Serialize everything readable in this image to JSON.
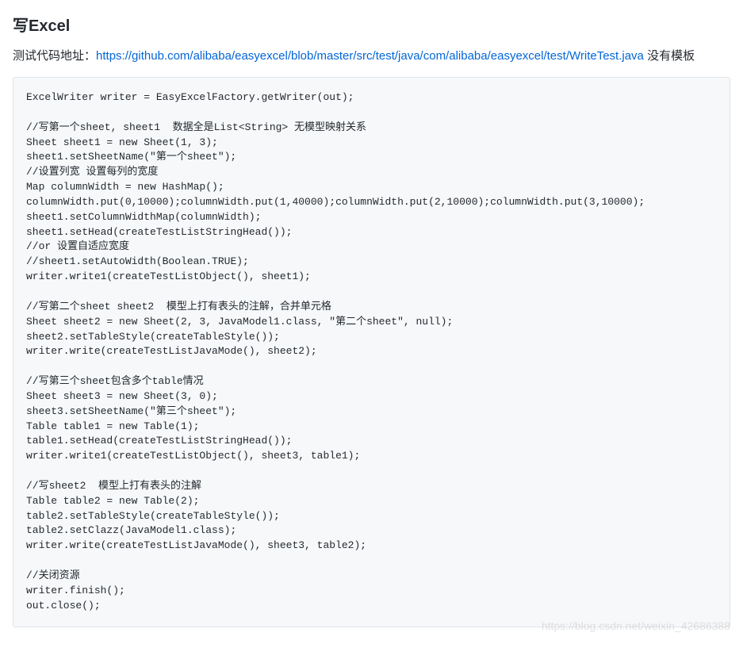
{
  "heading": "写Excel",
  "intro": {
    "prefix": "测试代码地址：",
    "link_text": "https://github.com/alibaba/easyexcel/blob/master/src/test/java/com/alibaba/easyexcel/test/WriteTest.java",
    "link_href": "https://github.com/alibaba/easyexcel/blob/master/src/test/java/com/alibaba/easyexcel/test/WriteTest.java",
    "suffix": " 没有模板"
  },
  "code": "ExcelWriter writer = EasyExcelFactory.getWriter(out);\n\n//写第一个sheet, sheet1  数据全是List<String> 无模型映射关系\nSheet sheet1 = new Sheet(1, 3);\nsheet1.setSheetName(\"第一个sheet\");\n//设置列宽 设置每列的宽度\nMap columnWidth = new HashMap();\ncolumnWidth.put(0,10000);columnWidth.put(1,40000);columnWidth.put(2,10000);columnWidth.put(3,10000);\nsheet1.setColumnWidthMap(columnWidth);\nsheet1.setHead(createTestListStringHead());\n//or 设置自适应宽度\n//sheet1.setAutoWidth(Boolean.TRUE);\nwriter.write1(createTestListObject(), sheet1);\n\n//写第二个sheet sheet2  模型上打有表头的注解，合并单元格\nSheet sheet2 = new Sheet(2, 3, JavaModel1.class, \"第二个sheet\", null);\nsheet2.setTableStyle(createTableStyle());\nwriter.write(createTestListJavaMode(), sheet2);\n\n//写第三个sheet包含多个table情况\nSheet sheet3 = new Sheet(3, 0);\nsheet3.setSheetName(\"第三个sheet\");\nTable table1 = new Table(1);\ntable1.setHead(createTestListStringHead());\nwriter.write1(createTestListObject(), sheet3, table1);\n\n//写sheet2  模型上打有表头的注解\nTable table2 = new Table(2);\ntable2.setTableStyle(createTableStyle());\ntable2.setClazz(JavaModel1.class);\nwriter.write(createTestListJavaMode(), sheet3, table2);\n\n//关闭资源\nwriter.finish();\nout.close();",
  "watermark": "https://blog.csdn.net/weixin_42686388"
}
